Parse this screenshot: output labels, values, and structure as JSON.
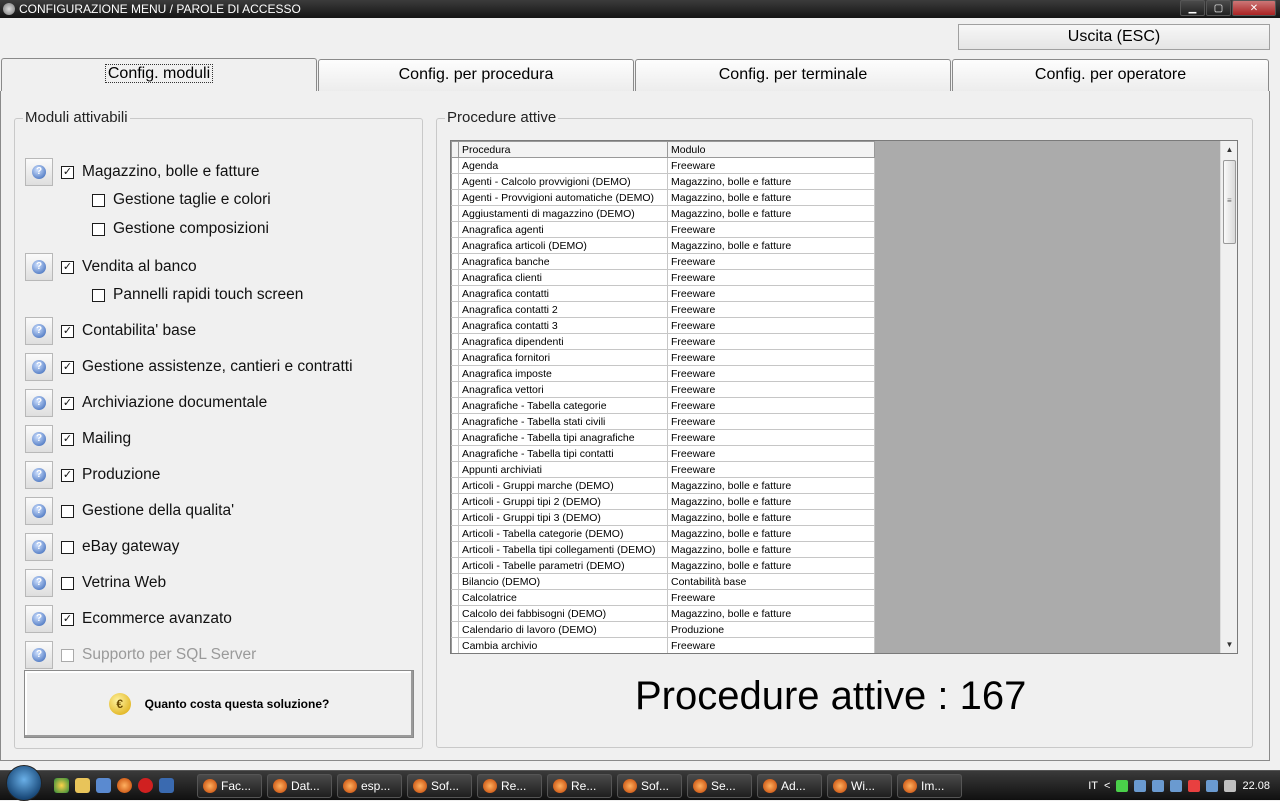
{
  "window": {
    "title": "CONFIGURAZIONE MENU / PAROLE DI ACCESSO",
    "minimize": "▁",
    "maximize": "▢",
    "close": "✕"
  },
  "exit_button": "Uscita (ESC)",
  "tabs": [
    {
      "label": "Config. moduli",
      "active": true
    },
    {
      "label": "Config. per procedura",
      "active": false
    },
    {
      "label": "Config. per terminale",
      "active": false
    },
    {
      "label": "Config. per operatore",
      "active": false
    }
  ],
  "modules": {
    "legend": "Moduli attivabili",
    "items": [
      {
        "label": "Magazzino, bolle e fatture",
        "checked": true
      },
      {
        "label": "Gestione taglie e colori",
        "checked": false,
        "sub": true
      },
      {
        "label": "Gestione composizioni",
        "checked": false,
        "sub": true
      },
      {
        "label": "Vendita al banco",
        "checked": true
      },
      {
        "label": "Pannelli rapidi touch screen",
        "checked": false,
        "sub": true
      },
      {
        "label": "Contabilita' base",
        "checked": true
      },
      {
        "label": "Gestione assistenze, cantieri e contratti",
        "checked": true
      },
      {
        "label": "Archiviazione documentale",
        "checked": true
      },
      {
        "label": "Mailing",
        "checked": true
      },
      {
        "label": "Produzione",
        "checked": true
      },
      {
        "label": "Gestione della qualita'",
        "checked": false
      },
      {
        "label": "eBay gateway",
        "checked": false
      },
      {
        "label": "Vetrina Web",
        "checked": false
      },
      {
        "label": "Ecommerce avanzato",
        "checked": true
      },
      {
        "label": "Supporto per SQL Server",
        "checked": false,
        "disabled": true
      }
    ],
    "cost_button": "Quanto costa questa soluzione?",
    "coin_symbol": "€"
  },
  "procedures": {
    "legend": "Procedure attive",
    "columns": [
      "Procedura",
      "Modulo"
    ],
    "rows": [
      [
        "Agenda",
        "Freeware"
      ],
      [
        "Agenti - Calcolo provvigioni (DEMO)",
        "Magazzino, bolle e fatture"
      ],
      [
        "Agenti - Provvigioni automatiche (DEMO)",
        "Magazzino, bolle e fatture"
      ],
      [
        "Aggiustamenti di magazzino (DEMO)",
        "Magazzino, bolle e fatture"
      ],
      [
        "Anagrafica agenti",
        "Freeware"
      ],
      [
        "Anagrafica articoli (DEMO)",
        "Magazzino, bolle e fatture"
      ],
      [
        "Anagrafica banche",
        "Freeware"
      ],
      [
        "Anagrafica clienti",
        "Freeware"
      ],
      [
        "Anagrafica contatti",
        "Freeware"
      ],
      [
        "Anagrafica contatti 2",
        "Freeware"
      ],
      [
        "Anagrafica contatti 3",
        "Freeware"
      ],
      [
        "Anagrafica dipendenti",
        "Freeware"
      ],
      [
        "Anagrafica fornitori",
        "Freeware"
      ],
      [
        "Anagrafica imposte",
        "Freeware"
      ],
      [
        "Anagrafica vettori",
        "Freeware"
      ],
      [
        "Anagrafiche - Tabella categorie",
        "Freeware"
      ],
      [
        "Anagrafiche - Tabella stati civili",
        "Freeware"
      ],
      [
        "Anagrafiche - Tabella tipi anagrafiche",
        "Freeware"
      ],
      [
        "Anagrafiche - Tabella tipi contatti",
        "Freeware"
      ],
      [
        "Appunti archiviati",
        "Freeware"
      ],
      [
        "Articoli - Gruppi marche (DEMO)",
        "Magazzino, bolle e fatture"
      ],
      [
        "Articoli - Gruppi tipi 2 (DEMO)",
        "Magazzino, bolle e fatture"
      ],
      [
        "Articoli - Gruppi tipi 3 (DEMO)",
        "Magazzino, bolle e fatture"
      ],
      [
        "Articoli - Tabella categorie (DEMO)",
        "Magazzino, bolle e fatture"
      ],
      [
        "Articoli - Tabella tipi collegamenti (DEMO)",
        "Magazzino, bolle e fatture"
      ],
      [
        "Articoli - Tabelle parametri (DEMO)",
        "Magazzino, bolle e fatture"
      ],
      [
        "Bilancio (DEMO)",
        "Contabilità base"
      ],
      [
        "Calcolatrice",
        "Freeware"
      ],
      [
        "Calcolo dei fabbisogni (DEMO)",
        "Magazzino, bolle e fatture"
      ],
      [
        "Calendario di lavoro (DEMO)",
        "Produzione"
      ],
      [
        "Cambia archivio",
        "Freeware"
      ]
    ],
    "count_label": "Procedure attive : 167"
  },
  "taskbar": {
    "tasks": [
      "Fac...",
      "Dat...",
      "esp...",
      "Sof...",
      "Re...",
      "Re...",
      "Sof...",
      "Se...",
      "Ad...",
      "Wi...",
      "Im..."
    ],
    "lang": "IT",
    "arrow": "<",
    "clock": "22.08"
  }
}
